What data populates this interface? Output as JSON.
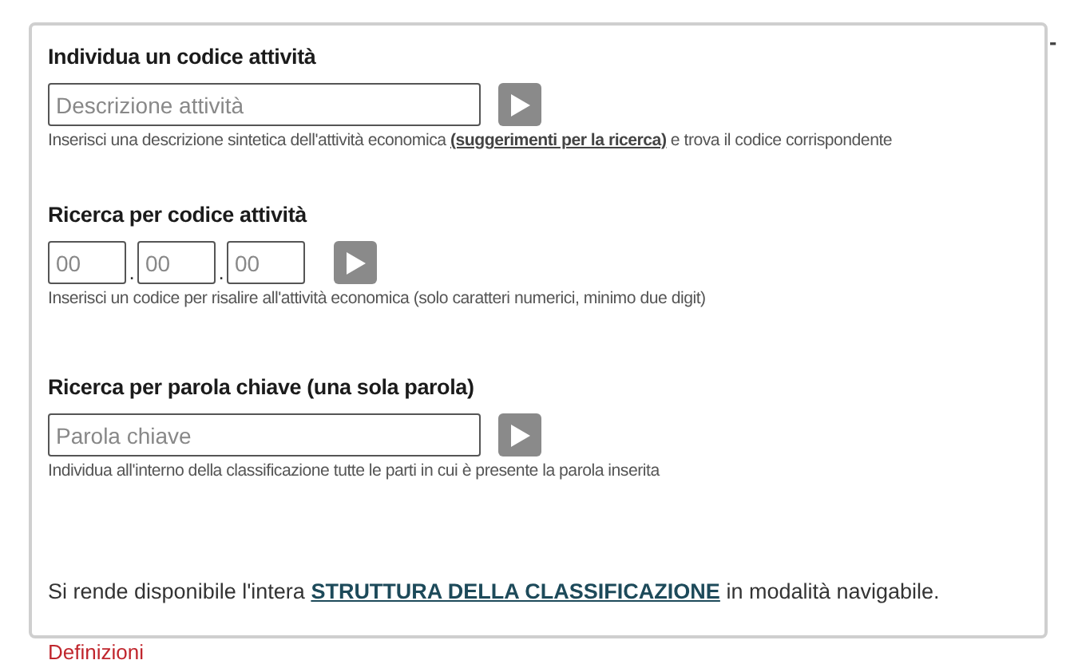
{
  "panel": {
    "collapse_mark": "-"
  },
  "sections": [
    {
      "kind": "text",
      "heading": "Individua un codice attività",
      "placeholder": "Descrizione attività",
      "help_parts": [
        "Inserisci una descrizione sintetica dell'attività economica ",
        "(suggerimenti per la ricerca)",
        " e trova il codice corrispondente"
      ]
    },
    {
      "kind": "code",
      "heading": "Ricerca per codice attività",
      "code_fields": [
        {
          "placeholder": "00"
        },
        {
          "placeholder": "00"
        },
        {
          "placeholder": "00"
        }
      ],
      "separator": ".",
      "help_parts": [
        "Inserisci un codice per risalire all'attività economica (solo caratteri numerici, minimo due digit)"
      ]
    },
    {
      "kind": "text",
      "heading": "Ricerca per parola chiave (una sola parola)",
      "placeholder": "Parola chiave",
      "help_parts": [
        "Individua all'interno della classificazione tutte le parti in cui è presente la parola inserita"
      ]
    }
  ],
  "footer": {
    "before": "Si rende disponibile l'intera ",
    "link": "STRUTTURA DELLA CLASSIFICAZIONE",
    "after": " in modalità navigabile."
  },
  "next_heading": "Definizioni"
}
